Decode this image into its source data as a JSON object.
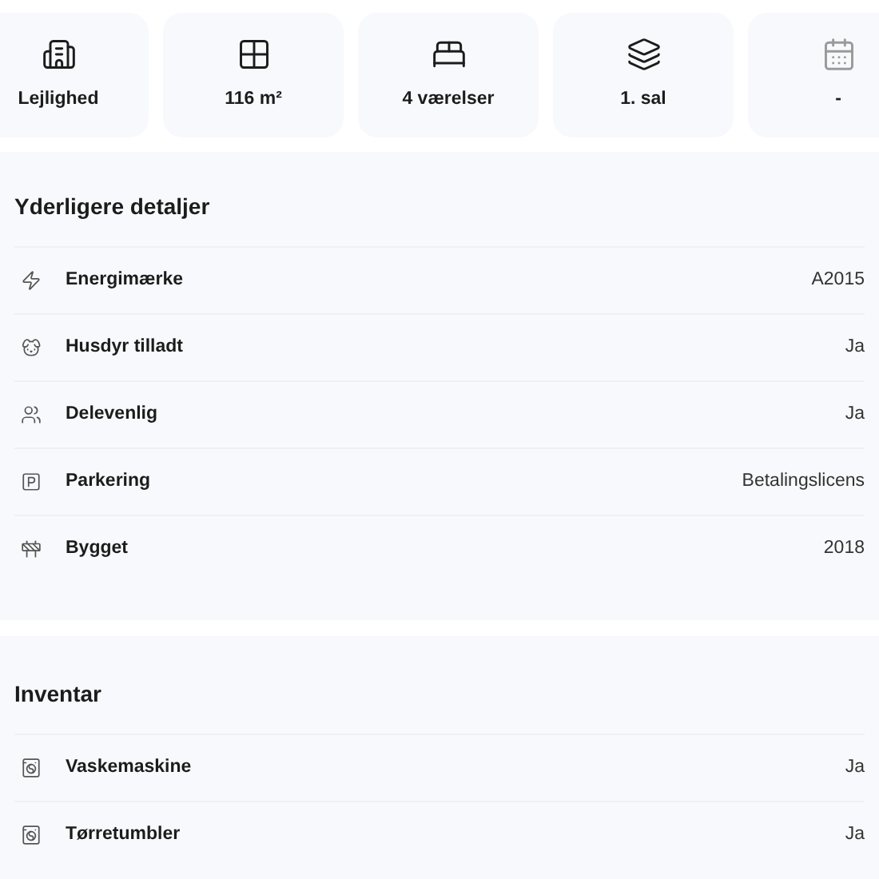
{
  "summary_cards": [
    {
      "label": "Lejlighed",
      "muted": false
    },
    {
      "label": "116 m²",
      "muted": false
    },
    {
      "label": "4 værelser",
      "muted": false
    },
    {
      "label": "1. sal",
      "muted": false
    },
    {
      "label": "-",
      "muted": true
    }
  ],
  "sections": [
    {
      "title": "Yderligere detaljer",
      "rows": [
        {
          "label": "Energimærke",
          "value": "A2015"
        },
        {
          "label": "Husdyr tilladt",
          "value": "Ja"
        },
        {
          "label": "Delevenlig",
          "value": "Ja"
        },
        {
          "label": "Parkering",
          "value": "Betalingslicens"
        },
        {
          "label": "Bygget",
          "value": "2018"
        }
      ]
    },
    {
      "title": "Inventar",
      "rows": [
        {
          "label": "Vaskemaskine",
          "value": "Ja"
        },
        {
          "label": "Tørretumbler",
          "value": "Ja"
        }
      ]
    }
  ]
}
